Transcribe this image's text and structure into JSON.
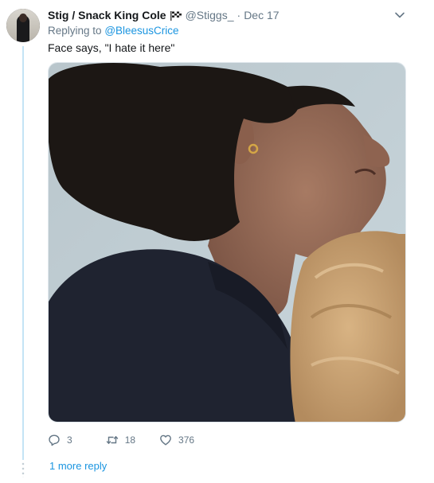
{
  "tweet": {
    "author_name": "Stig / Snack King Cole",
    "author_handle": "@Stiggs_",
    "separator": "·",
    "date": "Dec 17",
    "replying_prefix": "Replying to",
    "replying_to": "@BleesusCrice",
    "text": "Face says, \"I hate it here\"",
    "media_description_icon": "photo",
    "flag_icon": "checkered-flag-icon"
  },
  "actions": {
    "reply_count": "3",
    "retweet_count": "18",
    "like_count": "376"
  },
  "thread": {
    "more_replies_label": "1 more reply"
  },
  "colors": {
    "link": "#1b95e0",
    "secondary_text": "#657786",
    "primary_text": "#14171a",
    "thread_line": "#c4e4f5"
  }
}
